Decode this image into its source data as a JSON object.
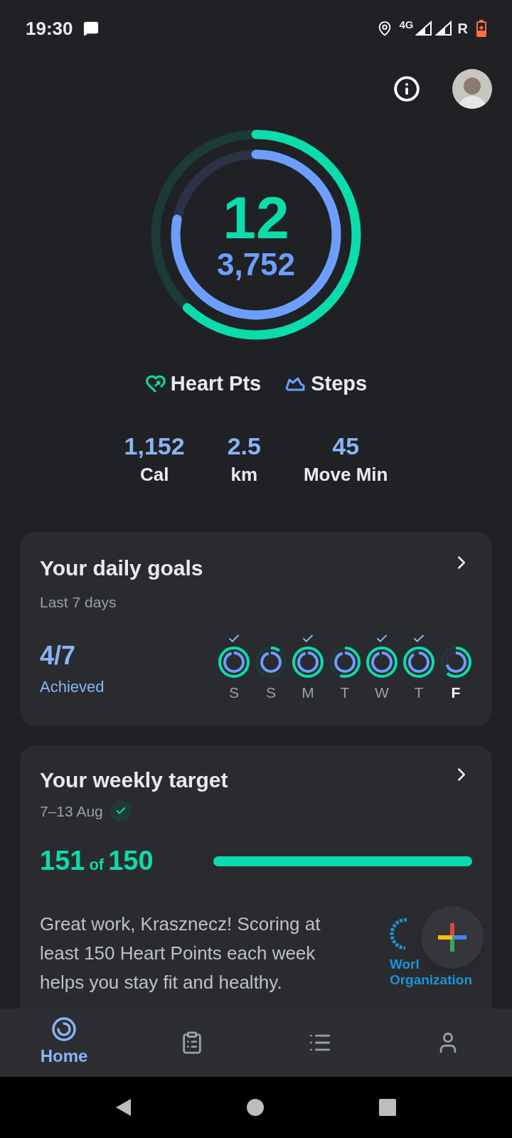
{
  "status_bar": {
    "time": "19:30",
    "network": "4G",
    "roaming": "R"
  },
  "rings": {
    "heart_points": "12",
    "steps": "3,752",
    "outer": {
      "level": 0.62
    },
    "inner": {
      "level": 0.78
    }
  },
  "legend": [
    {
      "kind": "heart",
      "label": "Heart Pts"
    },
    {
      "kind": "steps",
      "label": "Steps"
    }
  ],
  "stats": [
    {
      "value": "1,152",
      "label": "Cal"
    },
    {
      "value": "2.5",
      "label": "km"
    },
    {
      "value": "45",
      "label": "Move Min"
    }
  ],
  "daily_goals": {
    "title": "Your daily goals",
    "subtitle": "Last 7 days",
    "count": "4/7",
    "count_label": "Achieved",
    "days": [
      {
        "label": "S",
        "checked": true,
        "selected": false,
        "outer": {
          "level": 1
        },
        "inner": {
          "level": 0.95
        }
      },
      {
        "label": "S",
        "checked": false,
        "selected": false,
        "outer": {
          "level": 0.1
        },
        "inner": {
          "level": 0.95
        }
      },
      {
        "label": "M",
        "checked": true,
        "selected": false,
        "outer": {
          "level": 1
        },
        "inner": {
          "level": 0.95
        }
      },
      {
        "label": "T",
        "checked": false,
        "selected": false,
        "outer": {
          "level": 0.55
        },
        "inner": {
          "level": 0.95
        }
      },
      {
        "label": "W",
        "checked": true,
        "selected": false,
        "outer": {
          "level": 1
        },
        "inner": {
          "level": 0.95
        }
      },
      {
        "label": "T",
        "checked": true,
        "selected": false,
        "outer": {
          "level": 1
        },
        "inner": {
          "level": 0.9
        }
      },
      {
        "label": "F",
        "checked": false,
        "selected": true,
        "outer": {
          "level": 0.6
        },
        "inner": {
          "level": 0.7
        }
      }
    ]
  },
  "weekly_target": {
    "title": "Your weekly target",
    "dates": "7–13 Aug",
    "achieved": true,
    "score": "151",
    "of": "of",
    "target": "150",
    "progress": {
      "level": 1
    },
    "message": "Great work, Krasznecz! Scoring at least 150 Heart Points each week helps you stay fit and healthy.",
    "logo_line_1": "Worl",
    "logo_line_2": "Organization"
  },
  "nav": [
    {
      "kind": "home",
      "label": "Home",
      "selected": true
    },
    {
      "kind": "journal",
      "selected": false
    },
    {
      "kind": "browse",
      "selected": false
    },
    {
      "kind": "profile",
      "selected": false
    }
  ]
}
